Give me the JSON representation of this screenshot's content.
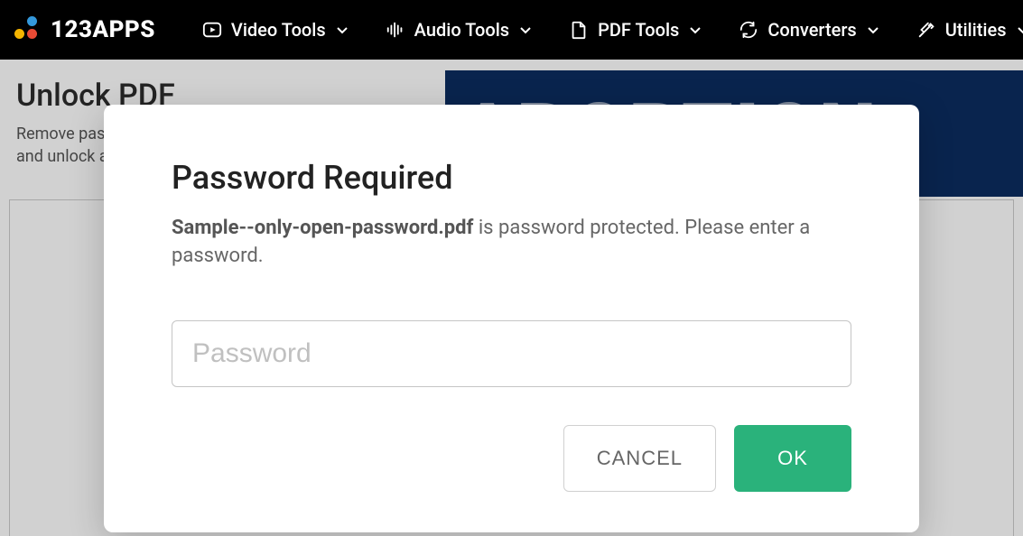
{
  "header": {
    "brand": "123APPS",
    "nav": [
      {
        "label": "Video Tools",
        "icon": "video-icon"
      },
      {
        "label": "Audio Tools",
        "icon": "audio-icon"
      },
      {
        "label": "PDF Tools",
        "icon": "pdf-icon"
      },
      {
        "label": "Converters",
        "icon": "converter-icon"
      },
      {
        "label": "Utilities",
        "icon": "utilities-icon"
      }
    ]
  },
  "page": {
    "title": "Unlock PDF",
    "subtitle_line1": "Remove password from PDF,",
    "subtitle_line2": "and unlock all permissions.",
    "banner_text": "ABORTION"
  },
  "modal": {
    "title": "Password Required",
    "filename": "Sample--only-open-password.pdf",
    "message_suffix": " is password protected. Please enter a password.",
    "password_placeholder": "Password",
    "password_value": "",
    "cancel_label": "CANCEL",
    "ok_label": "OK"
  }
}
